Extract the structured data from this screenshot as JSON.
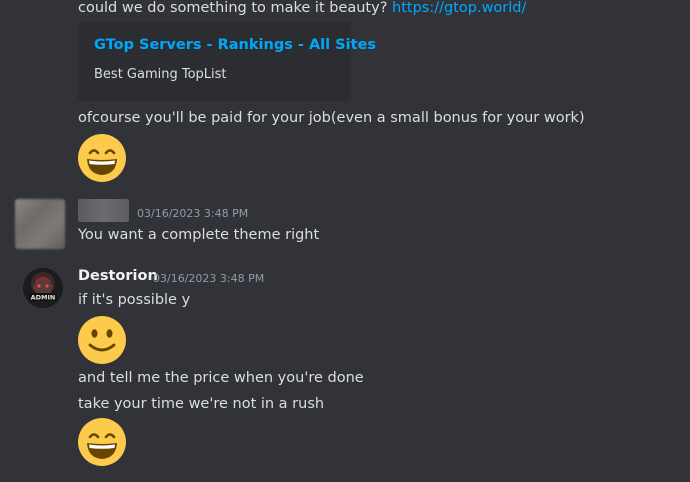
{
  "messages": [
    {
      "text_before_link": "could we do something to make it beauty? ",
      "link": "https://gtop.world/",
      "embed": {
        "title": "GTop Servers - Rankings - All Sites",
        "description": "Best Gaming TopList"
      }
    },
    {
      "text": "ofcourse you'll be paid for your job(even a small bonus for your work)",
      "emoji": "grinning-face-with-smiling-eyes"
    },
    {
      "author": "",
      "timestamp": "03/16/2023 3:48 PM",
      "text": "You want a complete theme right"
    },
    {
      "author": "Destorion",
      "timestamp": "03/16/2023 3:48 PM",
      "lines": [
        "if it's possible y",
        "and tell me the price when you're done",
        "take your time we're not in a rush"
      ],
      "emojis": [
        "slightly-smiling-face",
        "grinning-face-with-smiling-eyes"
      ],
      "avatar_badge": "ADMIN"
    }
  ]
}
